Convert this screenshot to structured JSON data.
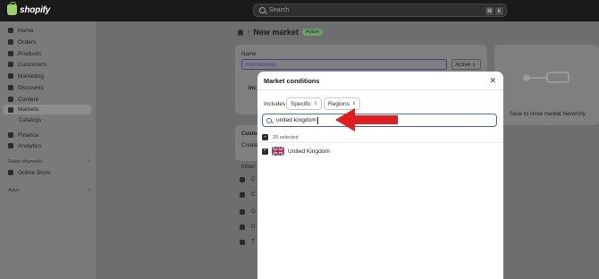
{
  "topbar": {
    "brand": "shopify",
    "search_placeholder": "Search",
    "shortcut_keys": [
      "⌘",
      "K"
    ]
  },
  "sidebar": {
    "items": [
      {
        "label": "Home",
        "icon": "home-icon"
      },
      {
        "label": "Orders",
        "icon": "orders-icon"
      },
      {
        "label": "Products",
        "icon": "tag-icon"
      },
      {
        "label": "Customers",
        "icon": "person-icon"
      },
      {
        "label": "Marketing",
        "icon": "megaphone-icon"
      },
      {
        "label": "Discounts",
        "icon": "discount-icon"
      },
      {
        "label": "Content",
        "icon": "content-icon"
      },
      {
        "label": "Markets",
        "icon": "globe-icon"
      }
    ],
    "sub_items": [
      "Catalogs"
    ],
    "items2": [
      {
        "label": "Finance",
        "icon": "bank-icon"
      },
      {
        "label": "Analytics",
        "icon": "chart-icon"
      }
    ],
    "sales_channels_label": "Sales channels",
    "online_store_label": "Online Store",
    "apps_label": "Apps"
  },
  "page": {
    "title": "New market",
    "status_badge": "Active",
    "name_label": "Name",
    "name_value": "International",
    "status_select": "Active",
    "inc_label_fragment": "Inc",
    "custom_fragment": "Custo",
    "create_fragment": "Create",
    "inherit_fragment": "Inheri",
    "list_fragments": [
      "C",
      "C",
      "O",
      "D",
      "T"
    ],
    "hierarchy_hint": "Save to show market hierarchy"
  },
  "modal": {
    "title": "Market conditions",
    "includes_label": "Includes",
    "specific_dropdown": "Specific",
    "regions_dropdown": "Regions",
    "search_value": "united kingdom",
    "selected_count": "26 selected",
    "results": [
      {
        "label": "United Kingdom",
        "checked": true
      }
    ]
  },
  "colors": {
    "focus_ring": "#3f6bd6",
    "annotation_arrow": "#e01e1e",
    "active_badge_bg": "#6f9c6a"
  }
}
